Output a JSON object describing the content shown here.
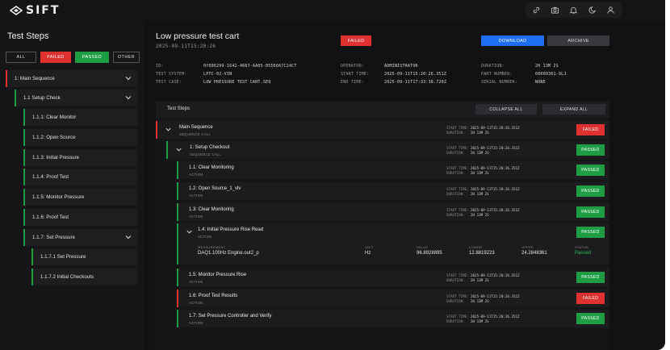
{
  "app": {
    "logo_text": "SIFT",
    "top_icons": [
      "link-icon",
      "camera-icon",
      "bell-icon",
      "moon-icon",
      "user-icon"
    ]
  },
  "sidebar": {
    "title": "Test Steps",
    "filters": [
      "ALL",
      "FAILED",
      "PASSED",
      "OTHER"
    ],
    "tree": [
      {
        "label": "1: Main Sequence",
        "expandable": true,
        "status": "failed"
      },
      {
        "label": "1.1 Setup Check",
        "expandable": true,
        "status": "passed"
      },
      {
        "label": "1.1.1: Clear Monitor",
        "status": "passed"
      },
      {
        "label": "1.1.2: Open Source",
        "status": "passed"
      },
      {
        "label": "1.1.3: Initial Pressure",
        "status": "passed"
      },
      {
        "label": "1.1.4: Proof Test",
        "status": "passed"
      },
      {
        "label": "1.1.5: Monitor Pressure",
        "status": "passed"
      },
      {
        "label": "1.1.6: Proof Test",
        "status": "passed"
      },
      {
        "label": "1.1.7: Set Pressure",
        "expandable": true,
        "status": "passed"
      },
      {
        "label": "1.1.7.1 Set Pressure",
        "status": "passed"
      },
      {
        "label": "1.1.7.2 Initial Checkouts",
        "status": "passed"
      }
    ]
  },
  "header": {
    "title": "Low pressure test cart",
    "timestamp": "2025-09-11T15:20:26",
    "status": "FAILED",
    "download_label": "DOWNLOAD",
    "archive_label": "ARCHIVE",
    "meta": {
      "id_label": "ID:",
      "id_value": "0f006299-1642-4667-AA05-0556667C24CT",
      "system_label": "TEST SYSTEM:",
      "system_value": "LPTC-02-VIN",
      "case_label": "TEST CASE:",
      "case_value": "LOW PRESSURE TEST CART.SEQ",
      "operator_label": "OPERATOR:",
      "operator_value": "ADMINISTRATOR",
      "start_label": "START TIME:",
      "start_value": "2025-09-11T15:20:26.351Z",
      "end_label": "END TIME:",
      "end_value": "2025-09-11T17:33:38.720Z",
      "duration_label": "DURATION:",
      "duration_value": "2H 13M 2S",
      "part_label": "PART NUMBER:",
      "part_value": "00000301-9LJ",
      "serial_label": "SERIAL NUMBER:",
      "serial_value": "NONE"
    }
  },
  "steps_panel": {
    "title": "Test Steps",
    "collapse_label": "COLLAPSE ALL",
    "expand_label": "EXPAND ALL",
    "time_labels": {
      "start": "START TIME:",
      "duration": "DURATION:"
    },
    "steps": [
      {
        "name": "Main Sequence",
        "type": "SEQUENCE CALL",
        "start": "2025-09-11T15:20:26.351Z",
        "duration": "2H 13M 2S",
        "status": "FAILED"
      },
      {
        "name": "1: Setup Checkout",
        "type": "SEQUENCE CALL",
        "start": "2025-09-11T15:20:26.351Z",
        "duration": "2H 13M 2S",
        "status": "PASSED"
      },
      {
        "name": "1.1: Clear Monitoring",
        "type": "ACTION",
        "start": "2025-09-11T15:20:26.351Z",
        "duration": "2H 13M 2S",
        "status": "PASSED"
      },
      {
        "name": "1.2: Open Source_1_vlv",
        "type": "ACTION",
        "start": "2025-09-11T15:20:26.351Z",
        "duration": "2H 13M 2S",
        "status": "PASSED"
      },
      {
        "name": "1.3: Clear Monitoring",
        "type": "ACTION",
        "start": "2025-09-11T15:20:26.351Z",
        "duration": "2H 13M 2S",
        "status": "PASSED"
      },
      {
        "name": "1.4: Initial Pressure Rise Read",
        "type": "ACTION",
        "status": "PASSED",
        "measurement": {
          "headers": [
            "MEASUREMENT",
            "UNIT",
            "VALUE",
            "LOWER",
            "UPPER",
            "STATUS"
          ],
          "row": [
            "DAQ1.100Hz Engine.out2_p",
            "Hz",
            "96.8928895",
            "12.8819223",
            "24.2848361",
            "Passed"
          ]
        }
      },
      {
        "name": "1.5: Monitor Pressure Rise",
        "type": "ACTION",
        "start": "2025-09-11T15:20:26.351Z",
        "duration": "2H 13M 2S",
        "status": "PASSED"
      },
      {
        "name": "1.6: Proof Test Results",
        "type": "ACTION",
        "start": "2025-09-11T15:20:26.351Z",
        "duration": "2H 13M 2S",
        "status": "FAILED"
      },
      {
        "name": "1.7: Set Pressure Controller and Verify",
        "type": "ACTION",
        "start": "2025-09-11T15:20:26.351Z",
        "duration": "2H 13M 2S",
        "status": "PASSED"
      }
    ]
  },
  "colors": {
    "pass": "#1f9d45",
    "fail": "#e03131",
    "primary": "#1c6ef2"
  }
}
